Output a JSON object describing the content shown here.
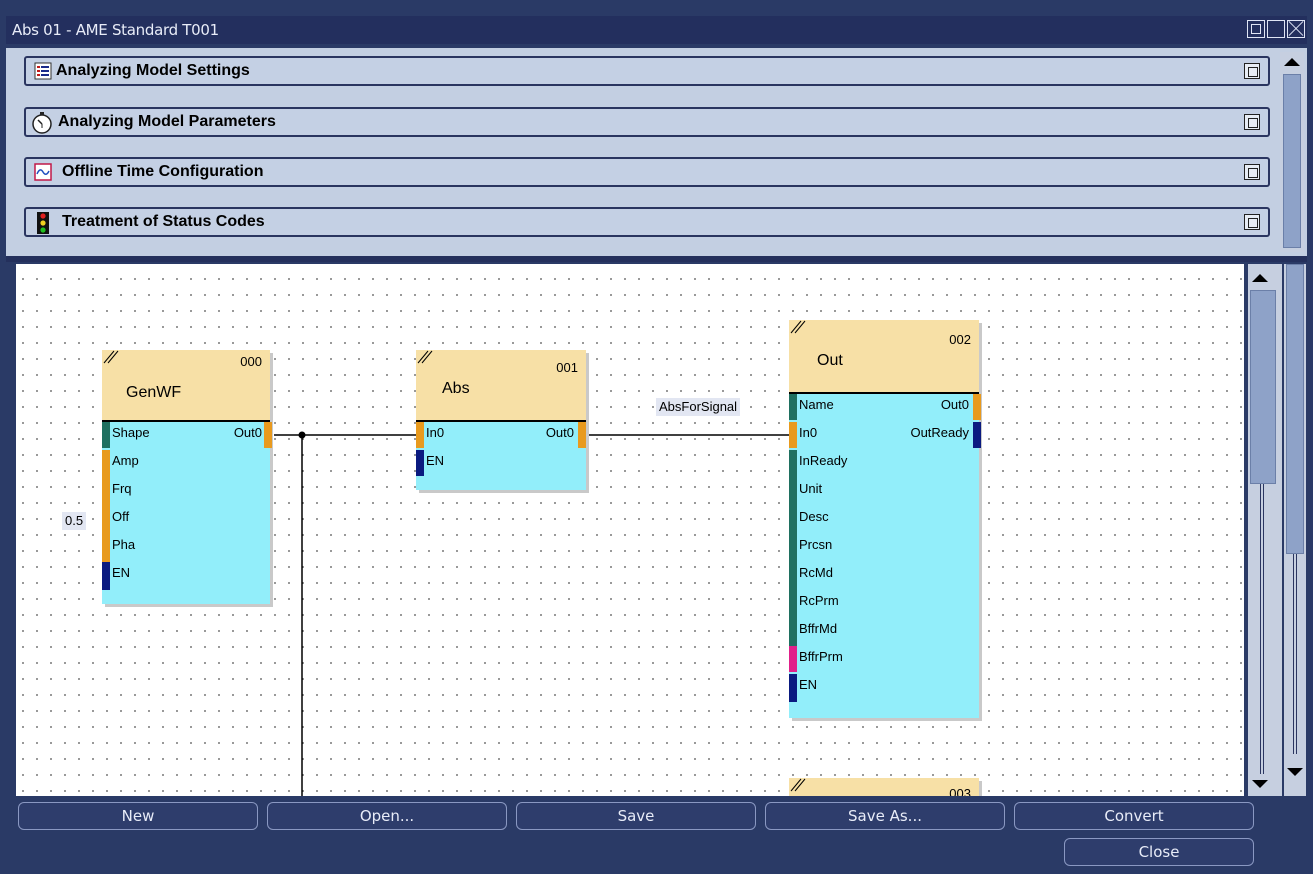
{
  "window": {
    "title": "Abs 01 - AME Standard T001"
  },
  "panels": [
    {
      "label": "Analyzing Model Settings",
      "icon": "list-settings-icon"
    },
    {
      "label": "Analyzing Model Parameters",
      "icon": "stopwatch-icon"
    },
    {
      "label": "Offline Time Configuration",
      "icon": "waveform-icon"
    },
    {
      "label": "Treatment of Status Codes",
      "icon": "traffic-light-icon"
    }
  ],
  "blocks": {
    "genwf": {
      "name": "GenWF",
      "number": "000",
      "inputs": [
        "Shape",
        "Amp",
        "Frq",
        "Off",
        "Pha",
        "EN"
      ],
      "outputs": [
        "Out0"
      ]
    },
    "abs": {
      "name": "Abs",
      "number": "001",
      "inputs": [
        "In0",
        "EN"
      ],
      "outputs": [
        "Out0"
      ]
    },
    "out": {
      "name": "Out",
      "number": "002",
      "inputs": [
        "Name",
        "In0",
        "InReady",
        "Unit",
        "Desc",
        "Prcsn",
        "RcMd",
        "RcPrm",
        "BffrMd",
        "BffrPrm",
        "EN"
      ],
      "outputs": [
        "Out0",
        "OutReady"
      ]
    },
    "next": {
      "number": "003"
    }
  },
  "labels": {
    "off_value": "0.5",
    "signal_name": "AbsForSignal"
  },
  "toolbar": {
    "new": "New",
    "open": "Open...",
    "save": "Save",
    "save_as": "Save As...",
    "convert": "Convert",
    "close": "Close"
  },
  "colors": {
    "block_header": "#f7e0a6",
    "block_body": "#92eefa",
    "pin_orange": "#e89a1e",
    "pin_teal": "#1f7060",
    "pin_navy": "#0a1a80",
    "pin_magenta": "#e0208a",
    "frame": "#2a3a66"
  }
}
